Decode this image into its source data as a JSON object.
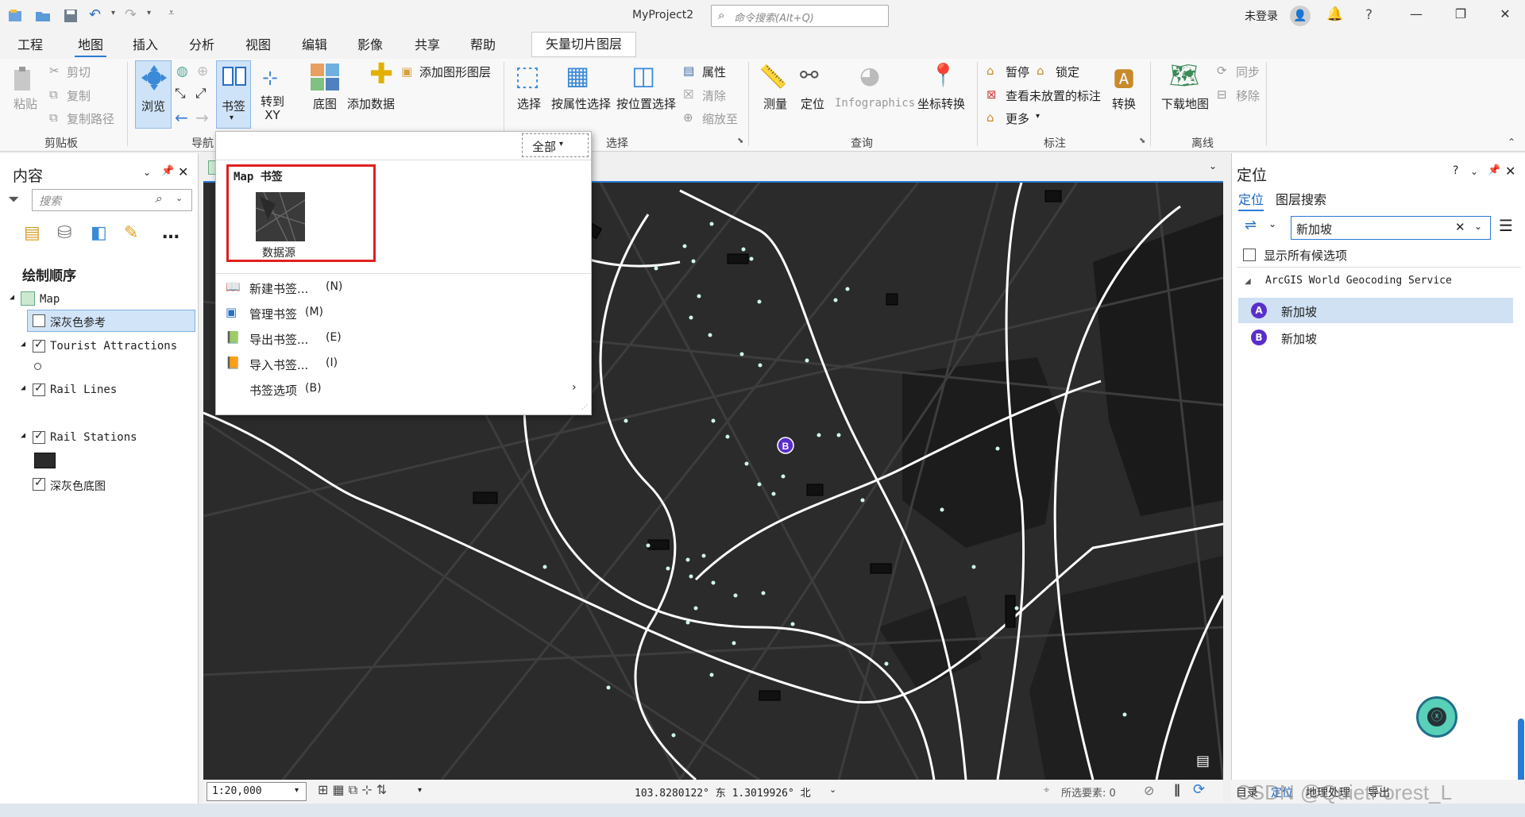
{
  "titlebar": {
    "project": "MyProject2",
    "command_search_placeholder": "命令搜索(Alt+Q)",
    "login": "未登录",
    "help": "?"
  },
  "tabs": [
    "工程",
    "地图",
    "插入",
    "分析",
    "视图",
    "编辑",
    "影像",
    "共享",
    "帮助"
  ],
  "active_tab": "地图",
  "contextual_tab": "矢量切片图层",
  "ribbon": {
    "clipboard": {
      "paste": "粘贴",
      "cut": "剪切",
      "copy": "复制",
      "copy_path": "复制路径",
      "group": "剪贴板"
    },
    "navigate": {
      "explore": "浏览",
      "bookmarks": "书签",
      "goto_xy": "转到\nXY",
      "group": "导航"
    },
    "layer": {
      "basemap": "底图",
      "add_data": "添加数据",
      "add_graphics": "添加图形图层"
    },
    "selection": {
      "select": "选择",
      "by_attr": "按属性选择",
      "by_loc": "按位置选择",
      "attributes": "属性",
      "clear": "清除",
      "zoom_to": "缩放至",
      "group": "选择"
    },
    "inquiry": {
      "measure": "测量",
      "locate": "定位",
      "infographics": "Infographics",
      "coord_conv": "坐标转换",
      "group": "查询"
    },
    "labeling": {
      "pause": "暂停",
      "lock": "锁定",
      "unplaced": "查看未放置的标注",
      "more": "更多",
      "convert": "转换",
      "group": "标注"
    },
    "offline": {
      "download": "下载地图",
      "sync": "同步",
      "remove": "移除",
      "group": "离线"
    }
  },
  "contents": {
    "title": "内容",
    "search_placeholder": "搜索",
    "draw_order": "绘制顺序",
    "layers": [
      {
        "name": "Map",
        "checked": null
      },
      {
        "name": "深灰色参考",
        "checked": false
      },
      {
        "name": "Tourist Attractions",
        "checked": true
      },
      {
        "name": "Rail Lines",
        "checked": true
      },
      {
        "name": "Rail Stations",
        "checked": true
      },
      {
        "name": "深灰色底图",
        "checked": true
      }
    ]
  },
  "bookmarks_menu": {
    "filter": "全部",
    "section": "Map 书签",
    "thumbnail_label": "数据源",
    "items": [
      {
        "label": "新建书签...",
        "key": "(N)"
      },
      {
        "label": "管理书签",
        "key": "(M)"
      },
      {
        "label": "导出书签...",
        "key": "(E)"
      },
      {
        "label": "导入书签...",
        "key": "(I)"
      },
      {
        "label": "书签选项",
        "key": "(B)"
      }
    ]
  },
  "map": {
    "scale": "1:20,000",
    "coords": "103.8280122° 东 1.3019926° 北",
    "selected_features": "所选要素: 0",
    "marker_label": "B"
  },
  "locate": {
    "title": "定位",
    "tab_locate": "定位",
    "tab_layer_search": "图层搜索",
    "query": "新加坡",
    "show_all": "显示所有候选项",
    "provider": "ArcGIS World Geocoding Service",
    "results": [
      {
        "marker": "A",
        "name": "新加坡"
      },
      {
        "marker": "B",
        "name": "新加坡"
      }
    ]
  },
  "bottom_tabs": [
    "目录",
    "定位",
    "地理处理",
    "导出"
  ],
  "watermark": "CSDN @QuietForest_L"
}
